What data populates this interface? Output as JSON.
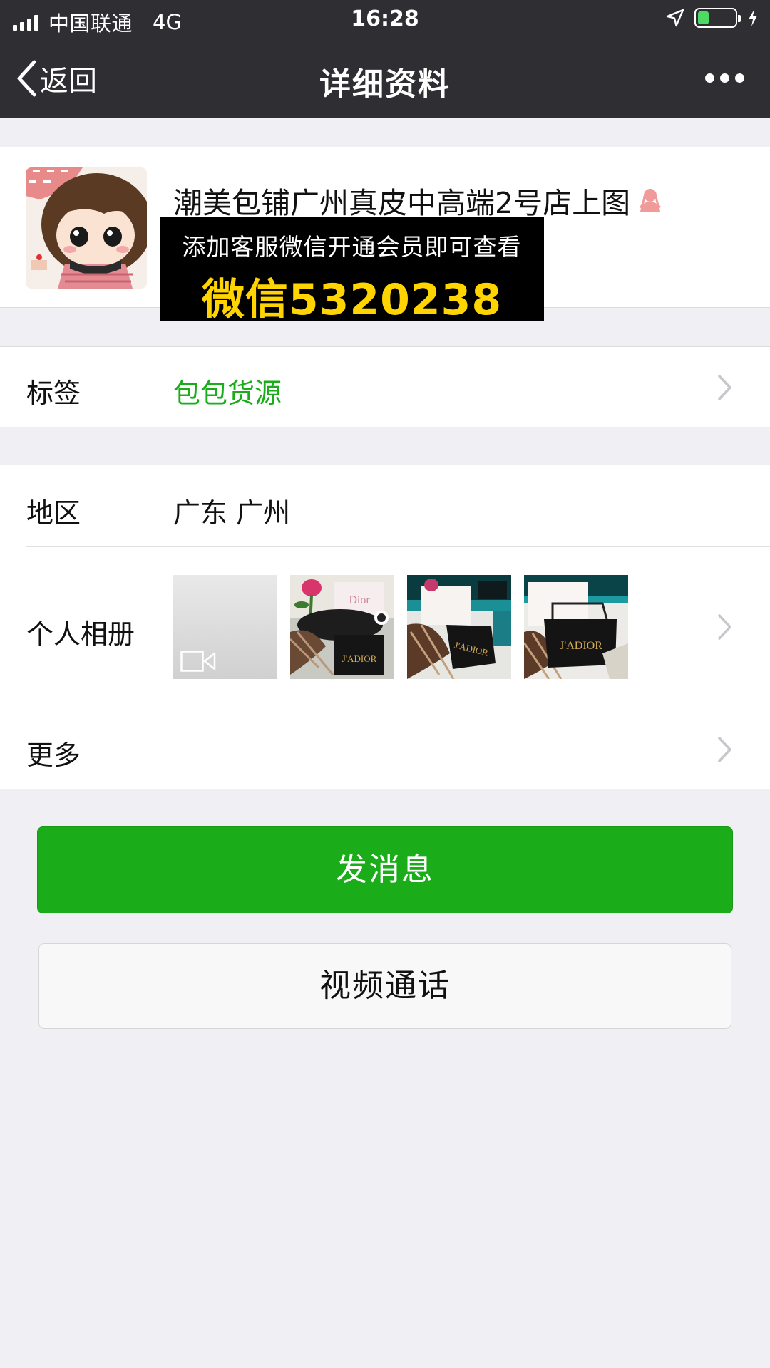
{
  "status_bar": {
    "carrier": "中国联通",
    "network": "4G",
    "time": "16:28",
    "battery_level": 0.3
  },
  "nav": {
    "back_label": "返回",
    "title": "详细资料"
  },
  "profile": {
    "name": "潮美包铺广州真皮中高端2号店上图",
    "promo_line1": "添加客服微信开通会员即可查看",
    "promo_line2": "微信5320238"
  },
  "tag_row": {
    "label": "标签",
    "value": "包包货源"
  },
  "region_row": {
    "label": "地区",
    "value": "广东 广州"
  },
  "album_row": {
    "label": "个人相册",
    "thumbnails": [
      {
        "label": "",
        "kind": "video"
      },
      {
        "label": "Dior",
        "kind": "photo"
      },
      {
        "label": "J'ADIOR",
        "kind": "photo"
      },
      {
        "label": "J'ADIOR",
        "kind": "photo"
      }
    ]
  },
  "more_row": {
    "label": "更多"
  },
  "buttons": {
    "send_message": "发消息",
    "video_call": "视频通话"
  },
  "colors": {
    "nav_background": "#2f2f33",
    "page_background": "#efeff4",
    "accent_green": "#1aad19",
    "promo_yellow": "#ffd400"
  },
  "icons": [
    "signal-icon",
    "location-arrow-icon",
    "battery-icon",
    "charging-bolt-icon",
    "back-chevron-icon",
    "more-dots-icon",
    "gender-female-icon",
    "video-camera-icon",
    "chevron-right-icon"
  ]
}
